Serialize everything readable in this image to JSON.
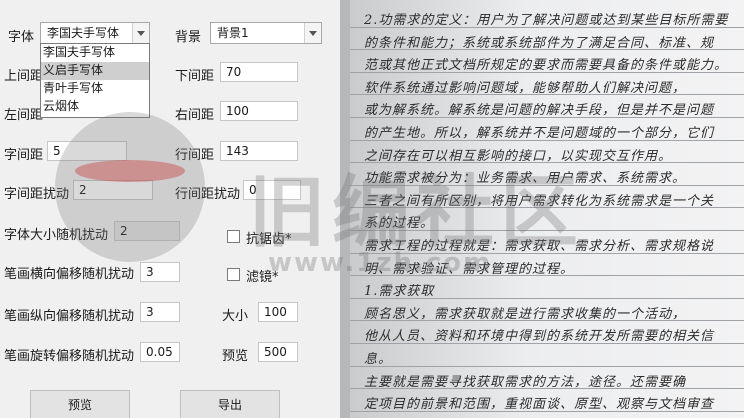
{
  "settings": {
    "font_label": "字体",
    "font_value": "李国夫手写体",
    "font_options": [
      "李国夫手写体",
      "义启手写体",
      "青叶手写体",
      "云烟体"
    ],
    "font_highlighted": "义启手写体",
    "background_label": "背景",
    "background_value": "背景1",
    "top_margin_label": "上间距",
    "bottom_margin_label": "下间距",
    "bottom_margin_value": "70",
    "left_margin_label": "左间距",
    "right_margin_label": "右间距",
    "right_margin_value": "100",
    "char_spacing_label": "字间距",
    "char_spacing_value": "5",
    "line_spacing_label": "行间距",
    "line_spacing_value": "143",
    "char_spacing_jitter_label": "字间距扰动",
    "char_spacing_jitter_value": "2",
    "line_spacing_jitter_label": "行间距扰动",
    "line_spacing_jitter_value": "0",
    "font_size_jitter_label": "字体大小随机扰动",
    "font_size_jitter_value": "2",
    "antialias_label": "抗锯齿*",
    "stroke_h_jitter_label": "笔画横向偏移随机扰动",
    "stroke_h_jitter_value": "3",
    "filter_label": "滤镜*",
    "stroke_v_jitter_label": "笔画纵向偏移随机扰动",
    "stroke_v_jitter_value": "3",
    "size_label": "大小",
    "size_value": "100",
    "stroke_rot_jitter_label": "笔画旋转偏移随机扰动",
    "stroke_rot_jitter_value": "0.05",
    "preview_label": "预览",
    "preview_value": "500"
  },
  "buttons": {
    "preview": "预览",
    "export": "导出"
  },
  "watermark": {
    "title": "旧编社区",
    "url": "www.1zh.com"
  },
  "handwriting_lines": [
    "2.功需求的定义：用户为了解决问题或达到某些目标所需要",
    "的条件和能力；系统或系统部件为了满足合同、标准、规",
    "范或其他正式文档所规定的要求而需要具备的条件或能力。",
    "    软件系统通过影响问题域，能够帮助人们解决问题，",
    "或为解系统。解系统是问题的解决手段，但是并不是问题",
    "的产生地。所以，解系统并不是问题域的一个部分，它们",
    "之间存在可以相互影响的接口，以实现交互作用。",
    "    功能需求被分为：业务需求、用户需求、系统需求。",
    "三者之间有所区别，将用户需求转化为系统需求是一个关",
    "系的过程。",
    "需求工程的过程就是：需求获取、需求分析、需求规格说",
    "明、需求验证、需求管理的过程。",
    "1.需求获取",
    "    顾名思义，需求获取就是进行需求收集的一个活动，",
    "他从人员、资料和环境中得到的系统开发所需要的相关信",
    "息。",
    "    主要就是需要寻找获取需求的方法，途径。还需要确",
    "定项目的前景和范围，重视面谈、原型、观察与文档审查"
  ]
}
